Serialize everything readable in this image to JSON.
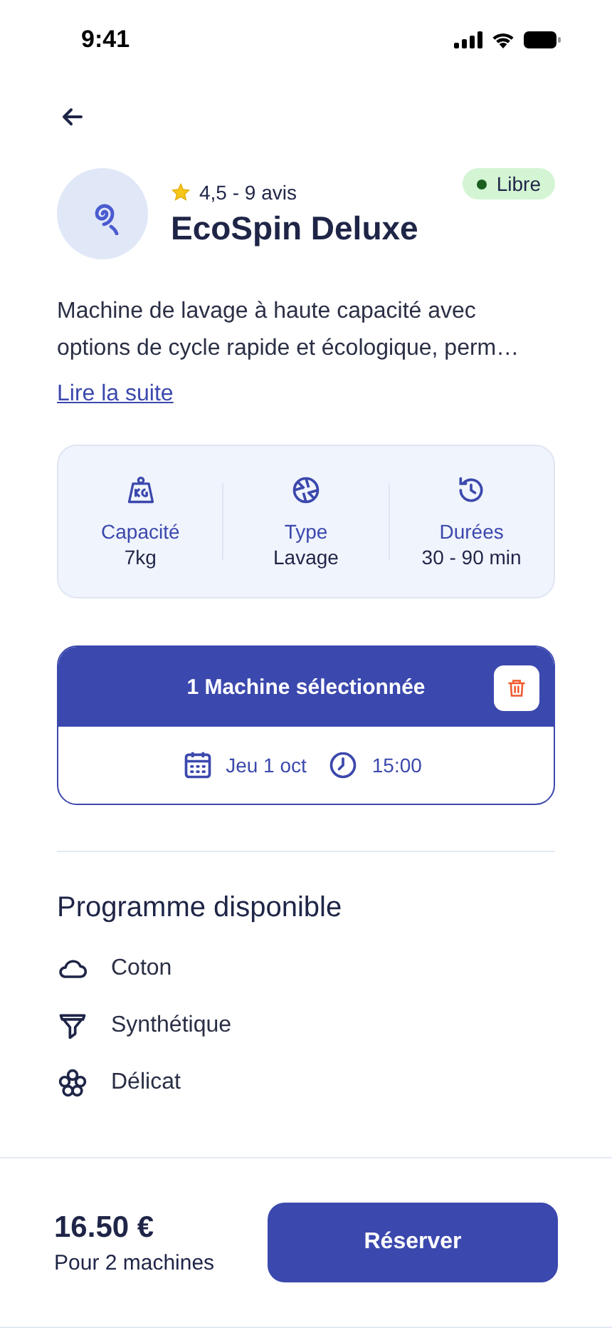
{
  "status_bar": {
    "time": "9:41"
  },
  "machine": {
    "rating": "4,5 - 9 avis",
    "name": "EcoSpin Deluxe",
    "status": {
      "label": "Libre",
      "kind": "available"
    },
    "description": "Machine de lavage à haute capacité avec options de cycle rapide et écologique, perm…",
    "link": "Lire la suite"
  },
  "specs": [
    {
      "kind": "weight",
      "label": "Capacité",
      "value": "7kg"
    },
    {
      "kind": "aperture",
      "label": "Type",
      "value": "Lavage"
    },
    {
      "kind": "history",
      "label": "Durées",
      "value": "30 - 90 min"
    }
  ],
  "selection": {
    "title": "1 Machine sélectionnée",
    "date": "Jeu 1 oct",
    "time": "15:00"
  },
  "programs": {
    "title": "Programme disponible",
    "items": [
      {
        "kind": "cloud",
        "label": "Coton"
      },
      {
        "kind": "funnel",
        "label": "Synthétique"
      },
      {
        "kind": "flower",
        "label": "Délicat"
      }
    ]
  },
  "footer": {
    "price": "16.50 €",
    "note": "Pour 2 machines",
    "button": "Réserver"
  }
}
